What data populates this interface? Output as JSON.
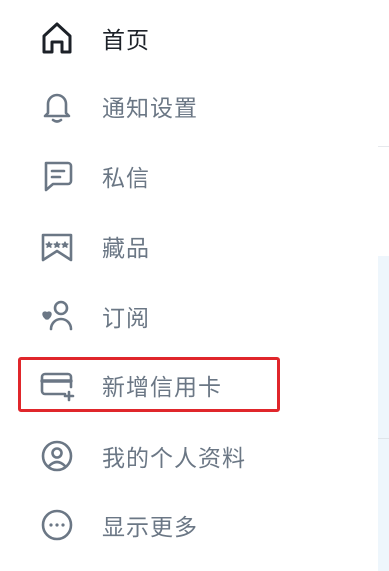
{
  "nav": {
    "items": [
      {
        "label": "首页",
        "icon": "home-icon"
      },
      {
        "label": "通知设置",
        "icon": "bell-icon"
      },
      {
        "label": "私信",
        "icon": "message-icon"
      },
      {
        "label": "藏品",
        "icon": "bookmark-icon"
      },
      {
        "label": "订阅",
        "icon": "subscribe-icon"
      },
      {
        "label": "新增信用卡",
        "icon": "credit-card-add-icon"
      },
      {
        "label": "我的个人资料",
        "icon": "profile-icon"
      },
      {
        "label": "显示更多",
        "icon": "more-icon"
      }
    ],
    "active_index": 0,
    "highlighted_index": 5
  },
  "colors": {
    "text_active": "#1c2128",
    "text_muted": "#6b7785",
    "highlight_border": "#e0262b"
  }
}
